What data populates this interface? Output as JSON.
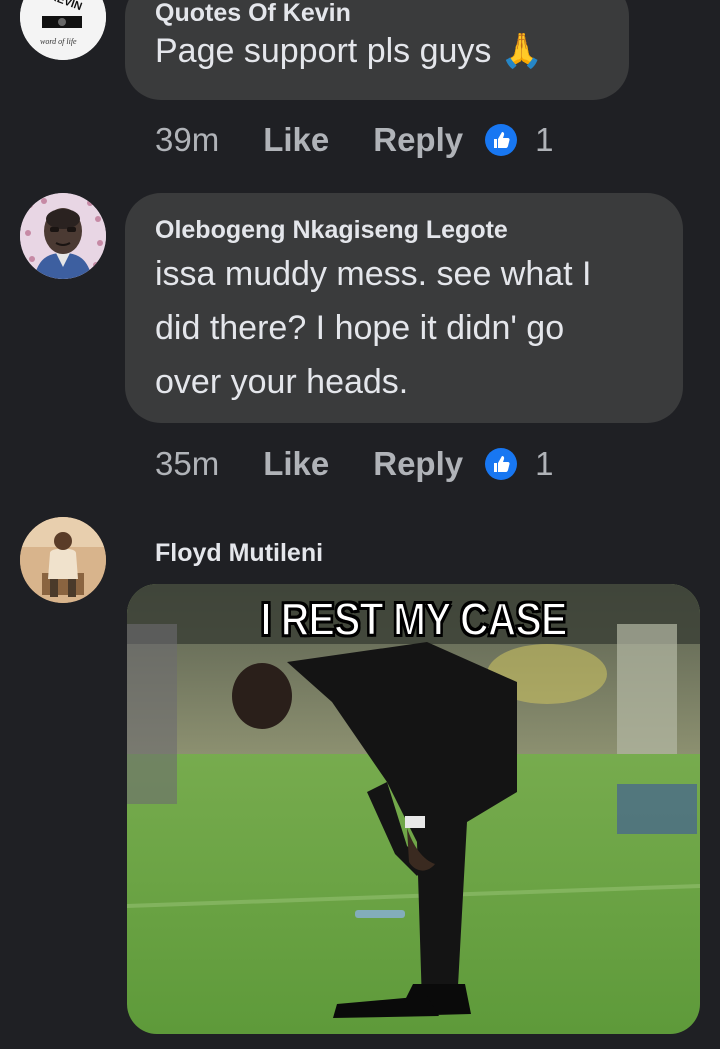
{
  "comments": [
    {
      "author": "Quotes Of Kevin",
      "text": "Page support pls guys 🙏",
      "time": "39m",
      "like_label": "Like",
      "reply_label": "Reply",
      "reaction_count": "1"
    },
    {
      "author": "Olebogeng Nkagiseng Legote",
      "text_lines": [
        "issa muddy mess. see what I",
        "did there? I hope it didn' go",
        "over your heads."
      ],
      "time": "35m",
      "like_label": "Like",
      "reply_label": "Reply",
      "reaction_count": "1"
    },
    {
      "author": "Floyd Mutileni",
      "meme_caption": "I REST MY CASE"
    }
  ],
  "colors": {
    "background": "#1f2024",
    "bubble": "#3a3b3c",
    "text_primary": "#e4e6eb",
    "text_secondary": "#b0b3b8",
    "like_badge": "#1877f2"
  },
  "icons": {
    "like_badge": "thumbs-up-icon"
  }
}
